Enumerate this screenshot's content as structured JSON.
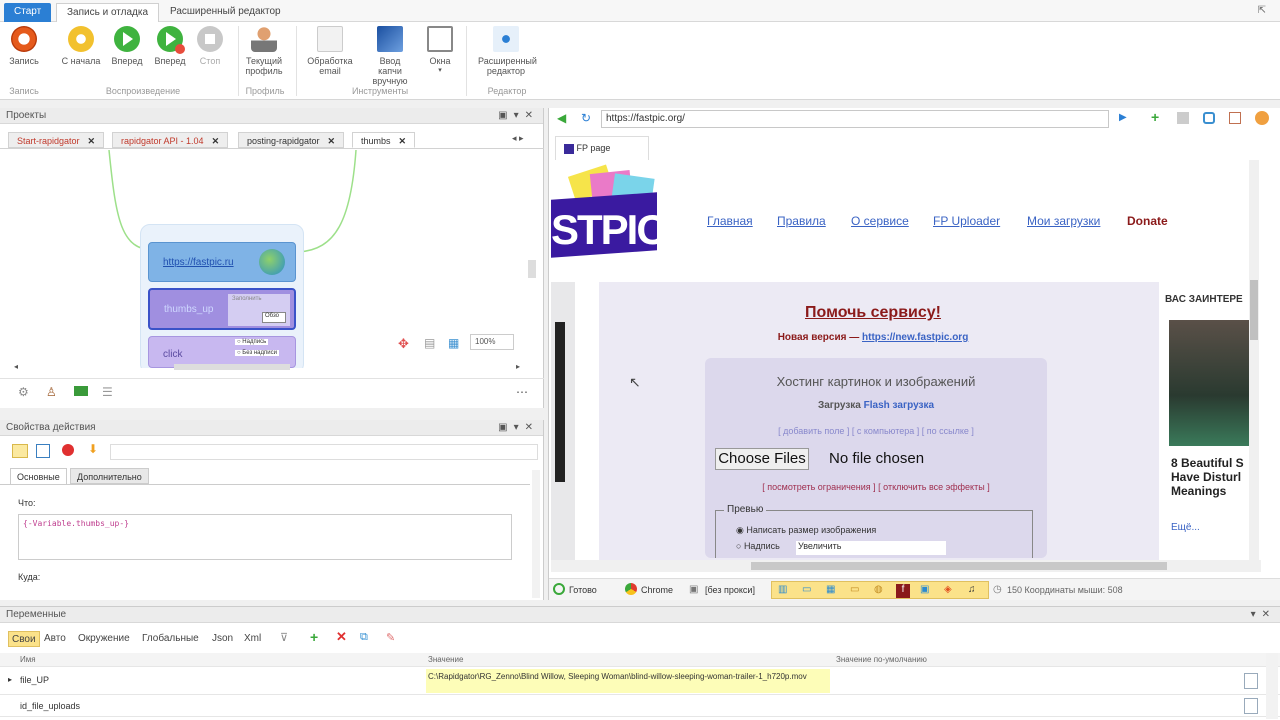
{
  "ribbon": {
    "tabs": [
      "Старт",
      "Запись и отладка",
      "Расширенный редактор"
    ],
    "buttons": {
      "record": "Запись",
      "from_start": "С начала",
      "forward": "Вперед",
      "forward2": "Вперед",
      "stop": "Стоп",
      "profile": "Текущий профиль",
      "email": "Обработка email",
      "captcha": "Ввод капчи вручную",
      "windows": "Окна",
      "ext_editor": "Расширенный редактор"
    },
    "groups": {
      "record": "Запись",
      "playback": "Воспроизведение",
      "profile": "Профиль",
      "tools": "Инструменты",
      "editor": "Редактор"
    }
  },
  "projects": {
    "title": "Проекты",
    "tabs": [
      "Start-rapidgator",
      "rapidgator API - 1.04",
      "posting-rapidgator",
      "thumbs"
    ],
    "nodes": {
      "url": "https://fastpic.ru",
      "thumbs": "thumbs_up",
      "small1": "Заполнить",
      "small2": "Обзо",
      "click": "click",
      "opt1": "Надпись",
      "opt2": "Без надписи"
    },
    "zoom": "100%"
  },
  "props": {
    "title": "Свойства действия",
    "tabs": [
      "Основные",
      "Дополнительно"
    ],
    "what_label": "Что:",
    "what_value": "{-Variable.thumbs_up-}",
    "where_label": "Куда:"
  },
  "browser": {
    "url": "https://fastpic.org/",
    "tab": "FP page",
    "nav": [
      "Главная",
      "Правила",
      "О сервисе",
      "FP Uploader",
      "Мои загрузки",
      "Donate"
    ],
    "logo": "STPIC",
    "help": "Помочь сервису!",
    "new_version_prefix": "Новая версия —",
    "new_version_link": "https://new.fastpic.org",
    "hosting_title": "Хостинг картинок и изображений",
    "upload_prefix": "Загрузка",
    "upload_link": "Flash загрузка",
    "add_field": "[ добавить поле ] [ с компьютера ] [ по ссылке ]",
    "choose_files": "Choose Files",
    "no_file": "No file chosen",
    "limits": "[ посмотреть ограничения ] [ отключить все эффекты ]",
    "preview_legend": "Превью",
    "opt_size": "Написать размер изображения",
    "opt_caption": "Надпись",
    "caption_value": "Увеличить",
    "side_title": "ВАС ЗАИНТЕРЕ",
    "side_text": "8 Beautiful S Have Disturl Meanings",
    "side_more": "Ещё..."
  },
  "bstatus": {
    "ready": "Готово",
    "browser": "Chrome",
    "proxy": "[без прокси]",
    "coords": "150  Координаты мыши: 508"
  },
  "vars": {
    "title": "Переменные",
    "toolbar": [
      "Свои",
      "Авто",
      "Окружение",
      "Глобальные",
      "Json",
      "Xml"
    ],
    "columns": [
      "Имя",
      "Значение",
      "Значение по-умолчанию"
    ],
    "rows": [
      {
        "name": "file_UP",
        "value": "C:\\Rapidgator\\RG_Zenno\\Blind Willow, Sleeping Woman\\blind-willow-sleeping-woman-trailer-1_h720p.mov",
        "default": ""
      },
      {
        "name": "id_file_uploads",
        "value": "",
        "default": ""
      }
    ]
  },
  "colors": {
    "accent": "#2b7fd4",
    "link": "#3a63c4",
    "help": "#8b1a1a",
    "highlight": "#fdfdb8",
    "start_tab": "#2b7fd4"
  }
}
